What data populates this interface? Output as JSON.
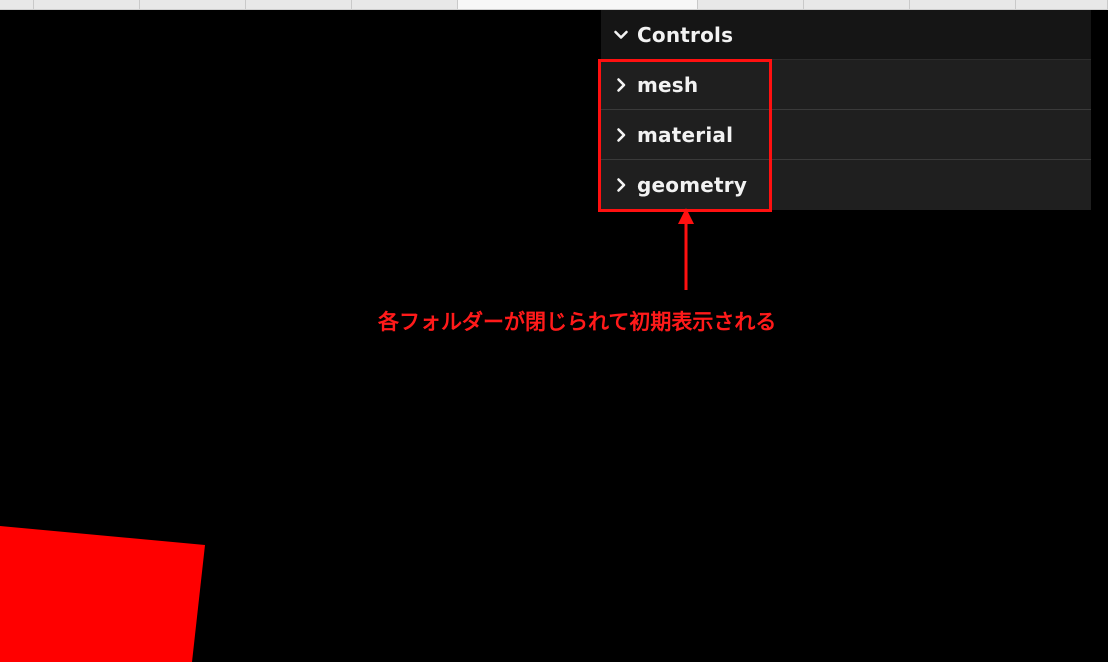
{
  "gui": {
    "title": "Controls",
    "title_icon": "chevron-down-icon",
    "folders": [
      {
        "label": "mesh",
        "icon": "chevron-right-icon",
        "expanded": false
      },
      {
        "label": "material",
        "icon": "chevron-right-icon",
        "expanded": false
      },
      {
        "label": "geometry",
        "icon": "chevron-right-icon",
        "expanded": false
      }
    ]
  },
  "annotation": {
    "text": "各フォルダーが閉じられて初期表示される",
    "color": "#ff1a1a"
  },
  "scene": {
    "background": "#000000",
    "mesh_color": "#ff0000"
  }
}
